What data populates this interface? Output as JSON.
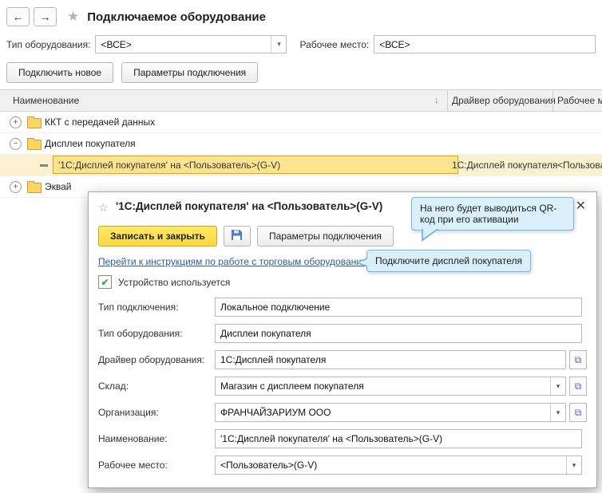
{
  "icons": {
    "back": "←",
    "forward": "→",
    "star": "★",
    "dialog_star": "☆",
    "sort_desc": "↓",
    "dropdown": "▾",
    "check": "✔",
    "open": "⧉",
    "close": "✕",
    "plus": "+",
    "minus": "−"
  },
  "colors": {
    "accent_yellow": "#ffd83e",
    "selected_row": "#ffe48f",
    "callout_bg": "#d9f0fb",
    "callout_border": "#79b9dc",
    "link": "#2c5f9e"
  },
  "header": {
    "title": "Подключаемое оборудование"
  },
  "filters": {
    "type_label": "Тип оборудования:",
    "type_value": "<ВСЕ>",
    "workplace_label": "Рабочее место:",
    "workplace_value": "<ВСЕ>"
  },
  "toolbar": {
    "connect_new": "Подключить новое",
    "connection_params": "Параметры подключения"
  },
  "table": {
    "columns": [
      "Наименование",
      "Драйвер оборудования",
      "Рабочее место"
    ],
    "rows": [
      {
        "kind": "group",
        "name": "ККТ с передачей данных"
      },
      {
        "kind": "group",
        "name": "Дисплеи покупателя"
      },
      {
        "kind": "item",
        "selected": true,
        "name": "'1С:Дисплей покупателя' на <Пользователь>(G-V)",
        "driver": "1С:Дисплей покупателя",
        "workplace": "<Пользователь>(G-V)"
      },
      {
        "kind": "group",
        "name": "Эквай"
      }
    ]
  },
  "dialog": {
    "title": "'1С:Дисплей покупателя' на <Пользователь>(G-V)",
    "save_close": "Записать и закрыть",
    "connection_params": "Параметры подключения",
    "instructions_link": "Перейти к инструкциям по работе с торговым оборудованием",
    "device_used": "Устройство используется",
    "fields": [
      {
        "label": "Тип подключения:",
        "value": "Локальное подключение"
      },
      {
        "label": "Тип оборудования:",
        "value": "Дисплеи покупателя"
      },
      {
        "label": "Драйвер оборудования:",
        "value": "1С:Дисплей покупателя"
      },
      {
        "label": "Склад:",
        "value": "Магазин с дисплеем покупателя"
      },
      {
        "label": "Организация:",
        "value": "ФРАНЧАЙЗАРИУМ ООО"
      },
      {
        "label": "Наименование:",
        "value": "'1С:Дисплей покупателя' на <Пользователь>(G-V)"
      },
      {
        "label": "Рабочее место:",
        "value": "<Пользователь>(G-V)"
      }
    ],
    "callouts": [
      {
        "text": "На него будет выводиться QR-код при его активации"
      },
      {
        "text": "Подключите дисплей покупателя"
      }
    ]
  }
}
